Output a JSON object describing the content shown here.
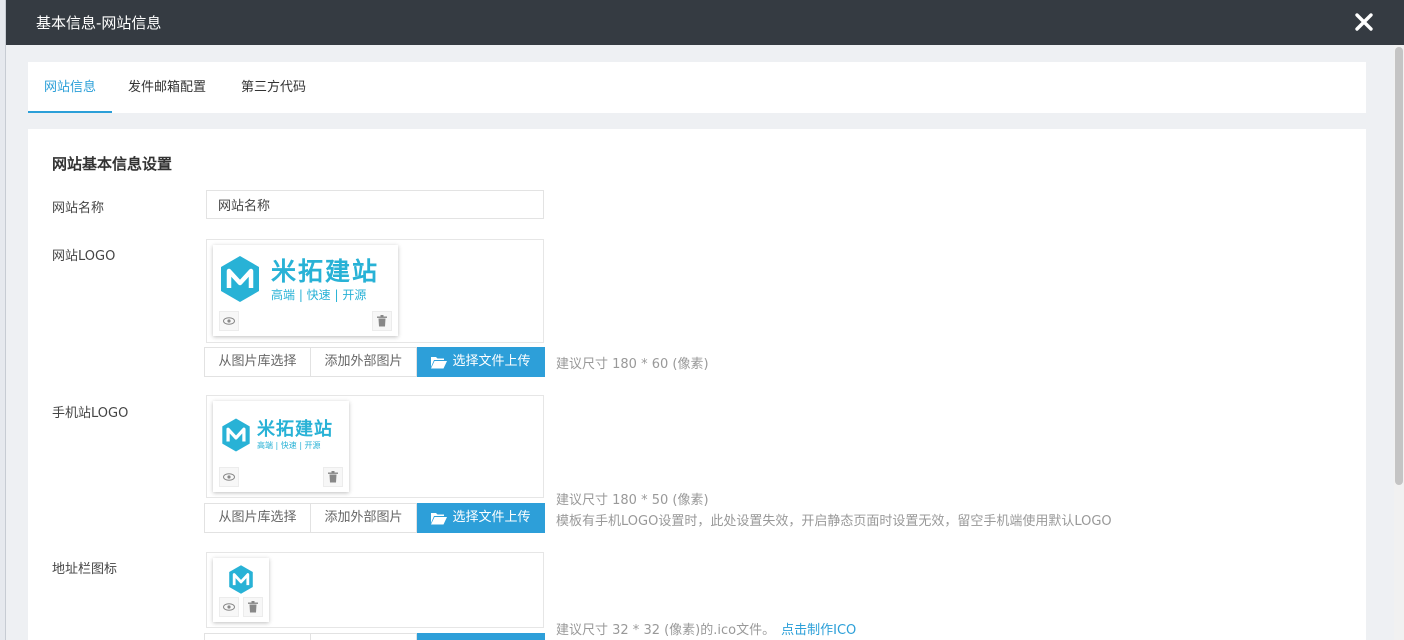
{
  "dialog": {
    "title": "基本信息-网站信息"
  },
  "tabs": [
    {
      "label": "网站信息",
      "active": true
    },
    {
      "label": "发件邮箱配置",
      "active": false
    },
    {
      "label": "第三方代码",
      "active": false
    }
  ],
  "section_title": "网站基本信息设置",
  "fields": {
    "site_name": {
      "label": "网站名称",
      "value": "网站名称"
    },
    "site_logo": {
      "label": "网站LOGO",
      "btn_library": "从图片库选择",
      "btn_external": "添加外部图片",
      "btn_upload": "选择文件上传",
      "hint": "建议尺寸 180 * 60 (像素)"
    },
    "mobile_logo": {
      "label": "手机站LOGO",
      "btn_library": "从图片库选择",
      "btn_external": "添加外部图片",
      "btn_upload": "选择文件上传",
      "hint1": "建议尺寸 180 * 50 (像素)",
      "hint2": "模板有手机LOGO设置时，此处设置失效，开启静态页面时设置无效，留空手机端使用默认LOGO"
    },
    "favicon": {
      "label": "地址栏图标",
      "hint": "建议尺寸 32 * 32 (像素)的.ico文件。",
      "link": "点击制作ICO"
    }
  },
  "brand": {
    "name": "米拓建站",
    "tagline": "高端 | 快速 | 开源",
    "mark_letter": "M",
    "color": "#28b2d6"
  },
  "colors": {
    "titlebar": "#353b42",
    "accent": "#2b9fd8",
    "upload_button": "#2d9fd9"
  },
  "icons": [
    "close-icon",
    "eye-icon",
    "trash-icon",
    "folder-open-icon"
  ]
}
